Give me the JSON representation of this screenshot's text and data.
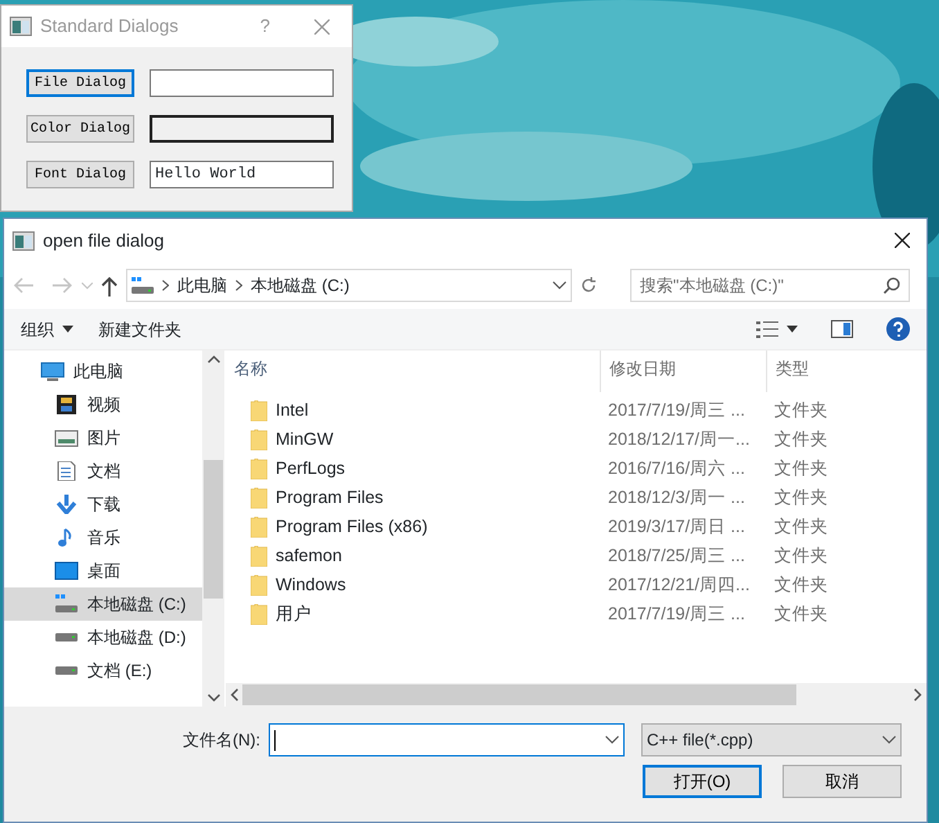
{
  "standard_dialogs": {
    "title": "Standard Dialogs",
    "help": "?",
    "rows": [
      {
        "label": "File Dialog",
        "focused": true,
        "kind": "text"
      },
      {
        "label": "Color Dialog",
        "focused": false,
        "kind": "color"
      },
      {
        "label": "Font Dialog",
        "focused": false,
        "kind": "text",
        "value": "Hello World"
      }
    ]
  },
  "file_dialog": {
    "title": "open file dialog",
    "path": [
      "此电脑",
      "本地磁盘 (C:)"
    ],
    "search": {
      "placeholder": "搜索\"本地磁盘 (C:)\""
    },
    "toolbar": [
      {
        "label": "组织",
        "kind": "menu"
      },
      {
        "label": "新建文件夹",
        "kind": "plain"
      }
    ],
    "sidebar": [
      {
        "label": "此电脑",
        "kind": "pc",
        "selected": false,
        "children": [
          {
            "label": "视频",
            "kind": "video",
            "selected": false
          },
          {
            "label": "图片",
            "kind": "pictures",
            "selected": false
          },
          {
            "label": "文档",
            "kind": "document",
            "selected": false
          },
          {
            "label": "下载",
            "kind": "download",
            "selected": false
          },
          {
            "label": "音乐",
            "kind": "music",
            "selected": false
          },
          {
            "label": "桌面",
            "kind": "desktop",
            "selected": false
          },
          {
            "label": "本地磁盘 (C:)",
            "kind": "system-drive",
            "selected": true
          },
          {
            "label": "本地磁盘 (D:)",
            "kind": "drive",
            "selected": false
          },
          {
            "label": "文档 (E:)",
            "kind": "drive",
            "selected": false
          }
        ]
      }
    ],
    "columns": [
      "名称",
      "修改日期",
      "类型"
    ],
    "rows": [
      {
        "name": "Intel",
        "date": "2017/7/19/周三 ...",
        "type": "文件夹"
      },
      {
        "name": "MinGW",
        "date": "2018/12/17/周一...",
        "type": "文件夹"
      },
      {
        "name": "PerfLogs",
        "date": "2016/7/16/周六 ...",
        "type": "文件夹"
      },
      {
        "name": "Program Files",
        "date": "2018/12/3/周一 ...",
        "type": "文件夹"
      },
      {
        "name": "Program Files (x86)",
        "date": "2019/3/17/周日 ...",
        "type": "文件夹"
      },
      {
        "name": "safemon",
        "date": "2018/7/25/周三 ...",
        "type": "文件夹"
      },
      {
        "name": "Windows",
        "date": "2017/12/21/周四...",
        "type": "文件夹"
      },
      {
        "name": "用户",
        "date": "2017/7/19/周三 ...",
        "type": "文件夹"
      }
    ],
    "filename_label": "文件名(N):",
    "filter": "C++ file(*.cpp)",
    "buttons": [
      {
        "label": "打开(O)",
        "default": true
      },
      {
        "label": "取消",
        "default": false
      }
    ]
  }
}
